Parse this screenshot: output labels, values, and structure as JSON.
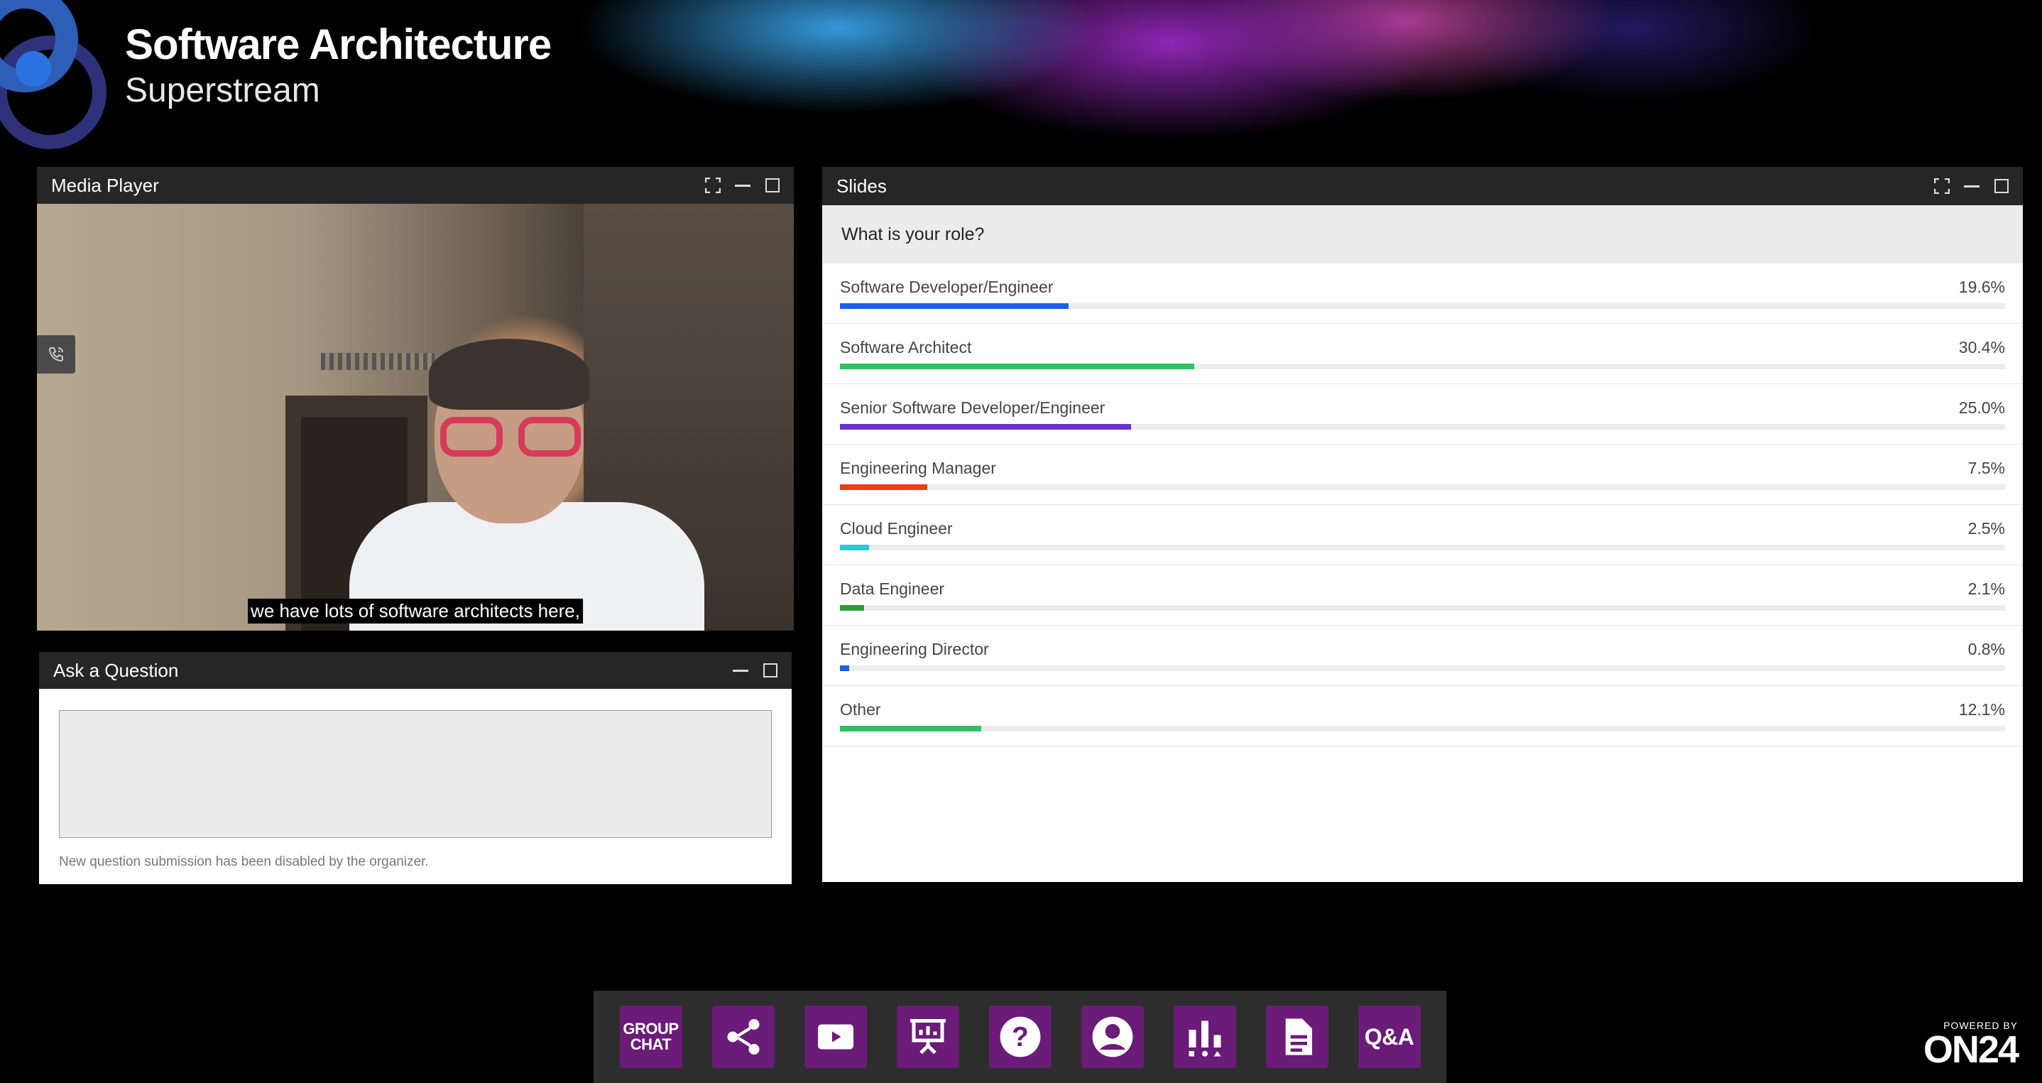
{
  "brand": {
    "title": "Software Architecture",
    "subtitle": "Superstream"
  },
  "media_player": {
    "title": "Media Player",
    "caption": "we have lots of software architects here,"
  },
  "ask_question": {
    "title": "Ask a Question",
    "input_value": "",
    "disabled_note": "New question submission has been disabled by the organizer."
  },
  "slides": {
    "title": "Slides",
    "question": "What is your role?",
    "options": [
      {
        "label": "Software Developer/Engineer",
        "percent_text": "19.6%",
        "value": 19.6,
        "color": "#1c5fe5"
      },
      {
        "label": "Software Architect",
        "percent_text": "30.4%",
        "value": 30.4,
        "color": "#2fc063"
      },
      {
        "label": "Senior Software Developer/Engineer",
        "percent_text": "25.0%",
        "value": 25.0,
        "color": "#6a2fcf"
      },
      {
        "label": "Engineering Manager",
        "percent_text": "7.5%",
        "value": 7.5,
        "color": "#ef3b1a"
      },
      {
        "label": "Cloud Engineer",
        "percent_text": "2.5%",
        "value": 2.5,
        "color": "#31c6d4"
      },
      {
        "label": "Data Engineer",
        "percent_text": "2.1%",
        "value": 2.1,
        "color": "#2d9c3b"
      },
      {
        "label": "Engineering Director",
        "percent_text": "0.8%",
        "value": 0.8,
        "color": "#1c5fe5"
      },
      {
        "label": "Other",
        "percent_text": "12.1%",
        "value": 12.1,
        "color": "#2fc063"
      }
    ]
  },
  "toolbar": {
    "group_chat_line1": "GROUP",
    "group_chat_line2": "CHAT",
    "qa_label": "Q&A",
    "icons": [
      "share-icon",
      "video-icon",
      "presentation-icon",
      "help-icon",
      "profile-icon",
      "poll-icon",
      "document-icon"
    ],
    "accent_color": "#6b1b78"
  },
  "powered_by": {
    "line1": "POWERED BY",
    "line2": "ON24"
  }
}
